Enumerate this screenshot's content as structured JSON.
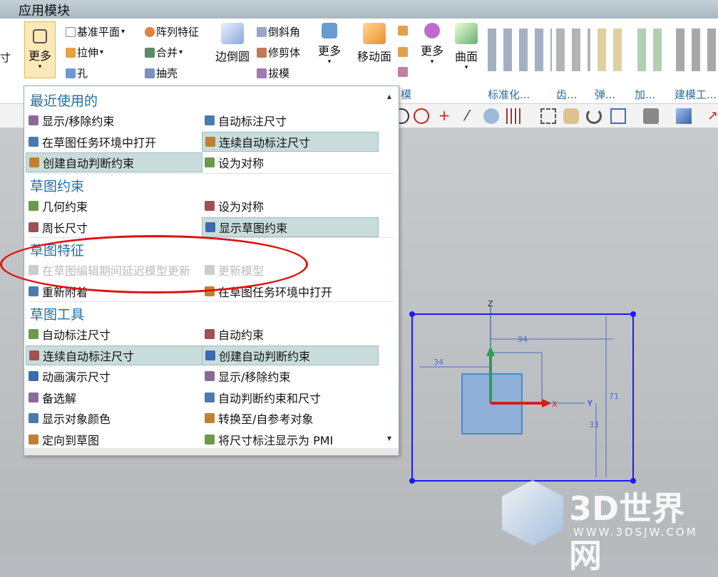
{
  "title": "应用模块",
  "ribbon": {
    "left_cut": "寸",
    "more1": "更多",
    "col1": [
      "基准平面",
      "拉伸",
      "孔"
    ],
    "col2": [
      "阵列特征",
      "合并",
      "抽壳"
    ],
    "edge_blend": "边倒圆",
    "col3": [
      "倒斜角",
      "修剪体",
      "拔模"
    ],
    "more2": "更多",
    "move_face": "移动面",
    "more3": "更多",
    "surface": "曲面",
    "groups": [
      "模",
      "标准化...",
      "齿...",
      "弹...",
      "加...",
      "建模工..."
    ]
  },
  "menu": {
    "sections": [
      {
        "title": "最近使用的",
        "items": [
          {
            "l": "显示/移除约束",
            "r": "自动标注尺寸",
            "hl": [
              false,
              false
            ]
          },
          {
            "l": "在草图任务环境中打开",
            "r": "连续自动标注尺寸",
            "hl": [
              false,
              true
            ]
          },
          {
            "l": "创建自动判断约束",
            "r": "设为对称",
            "hl": [
              true,
              false
            ]
          }
        ]
      },
      {
        "title": "草图约束",
        "items": [
          {
            "l": "几何约束",
            "r": "设为对称",
            "hl": [
              false,
              false
            ]
          },
          {
            "l": "周长尺寸",
            "r": "显示草图约束",
            "hl": [
              false,
              true
            ]
          }
        ]
      },
      {
        "title": "草图特征",
        "items": [
          {
            "l": "在草图编辑期间延迟模型更新",
            "r": "更新模型",
            "hl": [
              false,
              false
            ],
            "disabled": true
          },
          {
            "l": "重新附着",
            "r": "在草图任务环境中打开",
            "hl": [
              false,
              false
            ]
          }
        ]
      },
      {
        "title": "草图工具",
        "items": [
          {
            "l": "自动标注尺寸",
            "r": "自动约束",
            "hl": [
              false,
              false
            ]
          },
          {
            "l": "连续自动标注尺寸",
            "r": "创建自动判断约束",
            "hl": [
              true,
              true
            ]
          },
          {
            "l": "动画演示尺寸",
            "r": "显示/移除约束",
            "hl": [
              false,
              false
            ]
          },
          {
            "l": "备选解",
            "r": "自动判断约束和尺寸",
            "hl": [
              false,
              false
            ]
          },
          {
            "l": "显示对象颜色",
            "r": "转换至/自参考对象",
            "hl": [
              false,
              false
            ]
          },
          {
            "l": "定向到草图",
            "r": "将尺寸标注显示为 PMI",
            "hl": [
              false,
              false
            ]
          }
        ]
      }
    ]
  },
  "sketch": {
    "z": "Z",
    "y": "Y",
    "x": "X",
    "d94": "94",
    "d34": "34",
    "d71": "71",
    "d33": "33"
  },
  "watermark": {
    "brand": "3D世界网",
    "url": "WWW.3DSJW.COM"
  },
  "colors": {
    "accent": "#1f6fa6",
    "highlight": "#c9dcdc",
    "annotation": "#e01010",
    "sketch": "#1a1aff"
  }
}
